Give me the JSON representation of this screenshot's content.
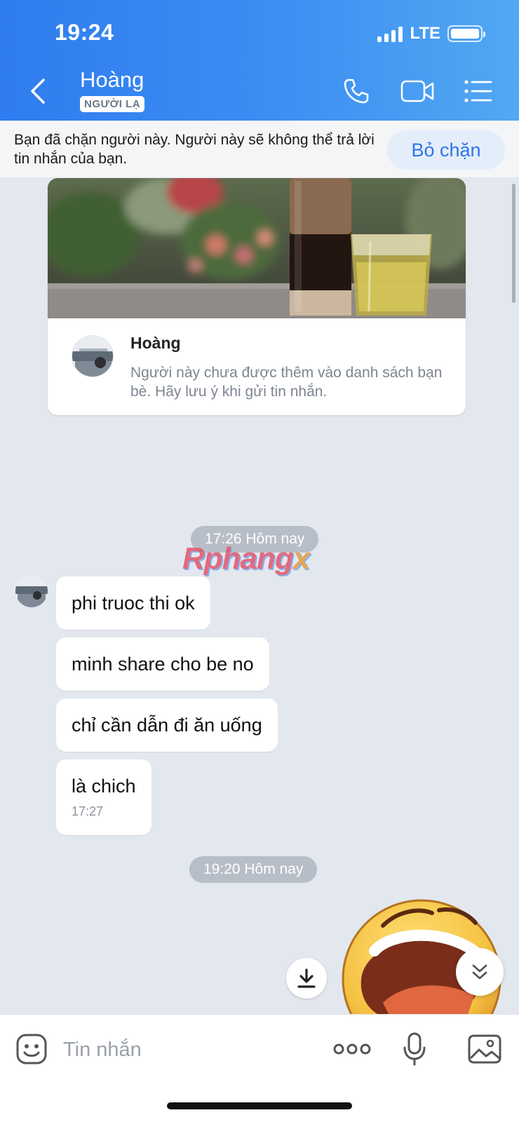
{
  "status_bar": {
    "time": "19:24",
    "network": "LTE"
  },
  "header": {
    "contact_name": "Hoàng",
    "stranger_badge": "NGƯỜI LẠ"
  },
  "blocked_banner": {
    "text": "Bạn đã chặn người này. Người này sẽ không thể trả lời tin nhắn của bạn.",
    "unblock_label": "Bỏ chặn"
  },
  "profile_card": {
    "name": "Hoàng",
    "note": "Người này chưa được thêm vào danh sách bạn bè. Hãy lưu ý khi gửi tin nhắn."
  },
  "watermark": {
    "main": "Rphang",
    "tail": "x"
  },
  "conversation": {
    "time_separators": [
      "17:26 Hôm nay",
      "19:20 Hôm nay"
    ],
    "messages": [
      {
        "text": "phi truoc thi ok"
      },
      {
        "text": "minh share cho be no"
      },
      {
        "text": "chỉ cần dẫn đi ăn uống"
      },
      {
        "text": "là chich",
        "time": "17:27"
      }
    ]
  },
  "composer": {
    "placeholder": "Tin nhắn"
  },
  "colors": {
    "header_start": "#2f7cf0",
    "header_end": "#52a8f2",
    "chat_background": "#e3e8ef",
    "accent": "#2f74e8"
  },
  "icons": [
    "back-chevron-icon",
    "phone-icon",
    "video-call-icon",
    "menu-list-icon",
    "download-icon",
    "chevron-double-down-icon",
    "emoji-icon",
    "more-dots-icon",
    "microphone-icon",
    "image-icon"
  ]
}
